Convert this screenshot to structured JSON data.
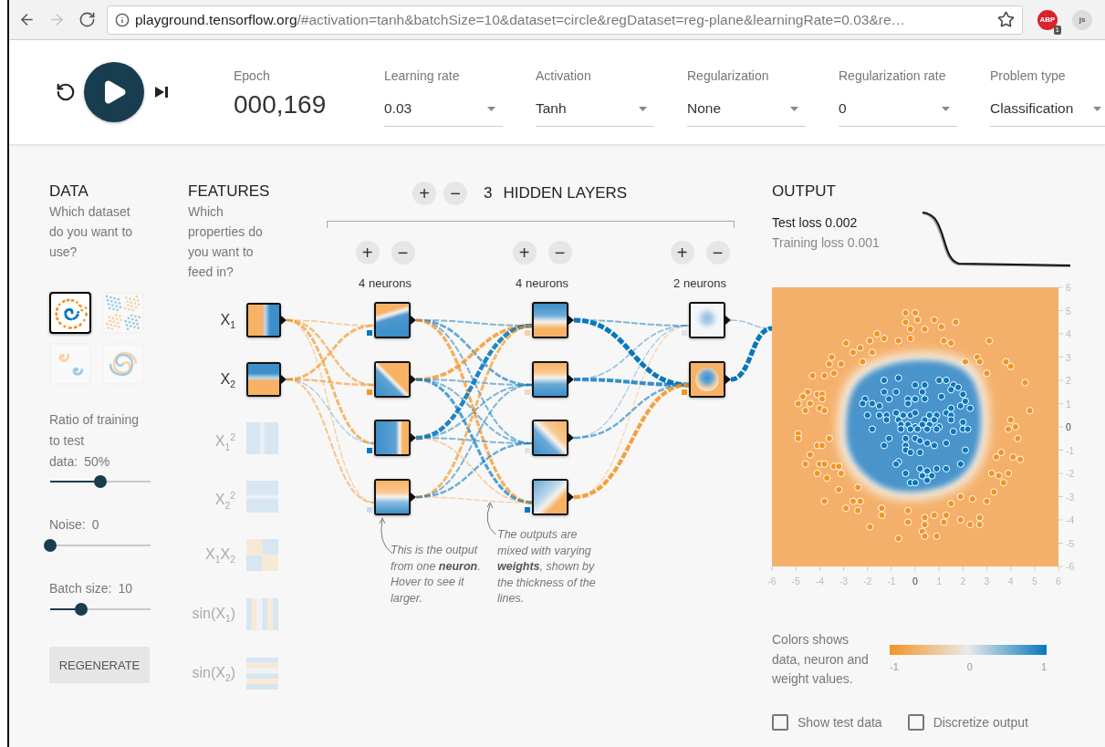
{
  "browser": {
    "nav": [
      {
        "kind": "back",
        "disabled": false
      },
      {
        "kind": "forward",
        "disabled": true
      },
      {
        "kind": "reload",
        "disabled": false
      }
    ],
    "url_host": "playground.tensorflow.org",
    "url_rest": "/#activation=tanh&batchSize=10&dataset=circle&regDataset=reg-plane&learningRate=0.03&re…",
    "bookmarked": false,
    "extensions": [
      {
        "kind": "abp",
        "label": "ABP",
        "badge": "1"
      },
      {
        "kind": "js",
        "label": "js"
      }
    ]
  },
  "controls": {
    "playing": false
  },
  "epoch": {
    "label": "Epoch",
    "value": "000,169"
  },
  "dropdowns": [
    {
      "label": "Learning rate",
      "value": "0.03"
    },
    {
      "label": "Activation",
      "value": "Tanh"
    },
    {
      "label": "Regularization",
      "value": "None"
    },
    {
      "label": "Regularization rate",
      "value": "0"
    },
    {
      "label": "Problem type",
      "value": "Classification"
    }
  ],
  "data": {
    "title": "DATA",
    "prompt": "Which dataset do you want to use?",
    "datasets": [
      {
        "kind": "circle",
        "selected": true
      },
      {
        "kind": "xor",
        "selected": false
      },
      {
        "kind": "gauss",
        "selected": false
      },
      {
        "kind": "spiral",
        "selected": false
      }
    ],
    "sliders": [
      {
        "label": "Ratio of training\nto test\ndata:",
        "value": "50%",
        "level": 0.5
      },
      {
        "label": "Noise:",
        "value": "0",
        "level": 0
      },
      {
        "label": "Batch size:",
        "value": "10",
        "level": 0.31
      }
    ],
    "regenerate": "REGENERATE"
  },
  "features": {
    "title": "FEATURES",
    "prompt": "Which properties do you want to feed in?",
    "items": [
      {
        "label": "X$_{1}$",
        "active": true
      },
      {
        "label": "X$_{2}$",
        "active": true
      },
      {
        "label": "X$_{1}$$^{2}$",
        "active": false
      },
      {
        "label": "X$_{2}$$^{2}$",
        "active": false
      },
      {
        "label": "X$_{1}$X$_{2}$",
        "active": false
      },
      {
        "label": "sin(X$_{1}$)",
        "active": false
      },
      {
        "label": "sin(X$_{2}$)",
        "active": false
      }
    ]
  },
  "network": {
    "add": "+",
    "remove": "−",
    "count": "3",
    "title": "HIDDEN LAYERS",
    "layers": [
      {
        "add": "+",
        "remove": "−",
        "label": "4 neurons",
        "neurons": [
          {
            "color": "#0877bd"
          },
          {
            "color": "#f59322"
          },
          {
            "color": "#0877bd"
          },
          {
            "color": "#c6dbef"
          }
        ]
      },
      {
        "add": "+",
        "remove": "−",
        "label": "4 neurons",
        "neurons": [
          {
            "color": "#f8cfa6"
          },
          {
            "color": "#ead9c6"
          },
          {
            "color": "#d6e4f0"
          },
          {
            "color": "#0877bd"
          }
        ]
      },
      {
        "add": "+",
        "remove": "−",
        "label": "2 neurons",
        "neurons": [
          {
            "color": "#dde3ea"
          },
          {
            "color": "#f59322"
          }
        ]
      }
    ],
    "annotations": [
      "This is the output from one **neuron**. Hover to see it larger.",
      "The outputs are mixed with varying **weights**, shown by the thickness of the lines."
    ]
  },
  "output": {
    "title": "OUTPUT",
    "test_loss": "Test loss 0.002",
    "training_loss": "Training loss 0.001",
    "chart_data": {
      "type": "scatter",
      "xlim": [
        -6,
        6
      ],
      "ylim": [
        -6,
        6
      ],
      "xticks": [
        {
          "value": -6,
          "label": "-6"
        },
        {
          "value": -5,
          "label": "-5"
        },
        {
          "value": -4,
          "label": "-4"
        },
        {
          "value": -3,
          "label": "-3"
        },
        {
          "value": -2,
          "label": "-2"
        },
        {
          "value": -1,
          "label": "-1"
        },
        {
          "value": 0,
          "label": "0"
        },
        {
          "value": 1,
          "label": "1"
        },
        {
          "value": 2,
          "label": "2"
        },
        {
          "value": 3,
          "label": "3"
        },
        {
          "value": 4,
          "label": "4"
        },
        {
          "value": 5,
          "label": "5"
        },
        {
          "value": 6,
          "label": "6"
        }
      ],
      "yticks": [
        {
          "value": 6,
          "label": "6"
        },
        {
          "value": 5,
          "label": "5"
        },
        {
          "value": 4,
          "label": "4"
        },
        {
          "value": 3,
          "label": "3"
        },
        {
          "value": 2,
          "label": "2"
        },
        {
          "value": 1,
          "label": "1"
        },
        {
          "value": 0,
          "label": "0"
        },
        {
          "value": -1,
          "label": "-1"
        },
        {
          "value": -2,
          "label": "-2"
        },
        {
          "value": -3,
          "label": "-3"
        },
        {
          "value": -4,
          "label": "-4"
        },
        {
          "value": -5,
          "label": "-5"
        },
        {
          "value": -6,
          "label": "-6"
        }
      ],
      "series": [
        {
          "color": "#f59322",
          "x": [
            -0.4,
            0,
            0.1,
            -0.4,
            0.8,
            1.7,
            0.4,
            1.1,
            -0.2,
            -1.6,
            -1.3,
            -1.9,
            -0.7,
            -0.2,
            1.2,
            1.5,
            3.1,
            -2.9,
            -2.3,
            -2.6,
            -1.8,
            -3.5,
            -3.6,
            -3.1,
            -2.2,
            2.1,
            2.6,
            2.7,
            3.8,
            4.0,
            -4.3,
            -3.8,
            -3.4,
            3.0,
            4.6,
            -4.5,
            -4.1,
            -3.9,
            -4.7,
            -3.9,
            -4.9,
            -4.4,
            -4.0,
            -4.6,
            -3.8,
            4.8,
            4.0,
            4.2,
            3.9,
            4.3,
            -4.9,
            -4.9,
            -3.6,
            -4.1,
            -3.9,
            -4.4,
            3.6,
            3.4,
            4.1,
            4.4,
            -4.6,
            -4.0,
            -3.8,
            -3.4,
            -3.2,
            -4.1,
            -3.1,
            -3.7,
            3.2,
            3.5,
            3.9,
            3.7,
            -3.2,
            -2.4,
            3.3,
            1.9,
            2.4,
            -3.8,
            -2.6,
            -2.3,
            -2.9,
            -2.4,
            1.5,
            3.0,
            -1.4,
            -0.3,
            1.3,
            0.8,
            -1.4,
            0.4,
            1.2,
            1.9,
            2.3,
            2.7,
            2.7,
            -0.3,
            0.4,
            0.3,
            -1.9,
            0.4,
            -0.7,
            0.9
          ],
          "values": [
            4.9,
            4.9,
            4.6,
            4.5,
            4.6,
            4.5,
            4.2,
            4.3,
            4.2,
            4.0,
            3.8,
            3.7,
            3.7,
            3.8,
            3.7,
            3.6,
            3.7,
            3.6,
            3.4,
            3.2,
            3.2,
            3.0,
            2.7,
            2.7,
            2.8,
            2.8,
            3.0,
            2.8,
            2.8,
            2.6,
            2.2,
            2.2,
            2.3,
            2.3,
            1.9,
            1.5,
            1.4,
            1.4,
            1.3,
            1.2,
            1.0,
            1.0,
            0.8,
            0.7,
            0.7,
            0.7,
            0.3,
            0.0,
            -0.1,
            -0.5,
            -0.3,
            -0.5,
            -0.5,
            -0.8,
            -0.8,
            -1.2,
            -1.1,
            -1.3,
            -1.3,
            -1.4,
            -1.6,
            -1.6,
            -1.6,
            -1.7,
            -1.7,
            -2.0,
            -2.0,
            -2.2,
            -2.0,
            -2.1,
            -2.0,
            -2.4,
            -2.7,
            -2.6,
            -2.8,
            -3.0,
            -3.1,
            -3.2,
            -3.2,
            -3.2,
            -3.5,
            -3.6,
            -3.3,
            -3.2,
            -3.5,
            -3.6,
            -3.8,
            -3.8,
            -3.8,
            -3.9,
            -4.1,
            -4.0,
            -4.2,
            -4.2,
            -3.9,
            -4.1,
            -4.2,
            -4.5,
            -4.3,
            -4.7,
            -4.8,
            -4.7
          ]
        },
        {
          "color": "#0877bd",
          "x": [
            -1.3,
            -0.7,
            0,
            0.4,
            1.0,
            1.3,
            1.6,
            1.8,
            -1.3,
            -0.8,
            0.3,
            1.5,
            -2.1,
            -1.1,
            -0.3,
            0,
            0.4,
            1.1,
            2.0,
            2.1,
            -2.2,
            -1.8,
            -1.5,
            -0.3,
            2.3,
            1.5,
            1.9,
            -2.0,
            -1.5,
            -1.2,
            -0.8,
            -0.5,
            -0.2,
            0,
            0.6,
            0.9,
            1.3,
            1.5,
            -1.2,
            -0.7,
            0.4,
            0.8,
            1.5,
            2.0,
            -0.6,
            -0.3,
            0,
            0.3,
            0.6,
            1.0,
            -1.8,
            -0.6,
            -0.2,
            0.1,
            0.5,
            0.9,
            2.0,
            2.2,
            1.6,
            -1.1,
            -0.4,
            0,
            0.2,
            0.5,
            1.3,
            -1.3,
            -0.4,
            0.8,
            -0.4,
            -0.2,
            0.2,
            2.1,
            -0.7,
            -0.8,
            0.2,
            0.5,
            0.9,
            1.3,
            1.9,
            -0.4,
            0.3,
            0.5,
            0.7,
            -0.2,
            0
          ],
          "values": [
            2.0,
            2.1,
            1.8,
            1.8,
            2.0,
            2.0,
            1.8,
            1.7,
            1.5,
            1.5,
            1.5,
            1.6,
            1.2,
            1.2,
            1.2,
            1.2,
            1.2,
            1.3,
            1.4,
            1.1,
            1.0,
            1.0,
            0.9,
            1.0,
            0.8,
            0.8,
            0.9,
            0.5,
            0.5,
            0.5,
            0.6,
            0.5,
            0.5,
            0.6,
            0.5,
            0.5,
            0.6,
            0.5,
            0.3,
            0.3,
            0.3,
            0.3,
            0.3,
            0.2,
            0.1,
            0.1,
            0,
            0.1,
            0.1,
            0,
            -0.1,
            -0.1,
            -0.1,
            -0.1,
            -0.1,
            -0.1,
            -0.1,
            -0.1,
            -0.2,
            -0.5,
            -0.5,
            -0.5,
            -0.6,
            -0.7,
            -0.7,
            -0.8,
            -0.8,
            -0.8,
            -1.0,
            -1.1,
            -1.1,
            -1.0,
            -1.5,
            -1.6,
            -1.8,
            -1.9,
            -1.8,
            -1.8,
            -1.6,
            -2.0,
            -2.1,
            -2.3,
            -2.1,
            -2.4,
            -2.4
          ]
        }
      ]
    },
    "legend": {
      "text": "Colors shows data, neuron and weight values.",
      "ticks": [
        "-1",
        "0",
        "1"
      ]
    },
    "options": [
      {
        "label": "Show test data",
        "checked": false
      },
      {
        "label": "Discretize output",
        "checked": false
      }
    ]
  }
}
